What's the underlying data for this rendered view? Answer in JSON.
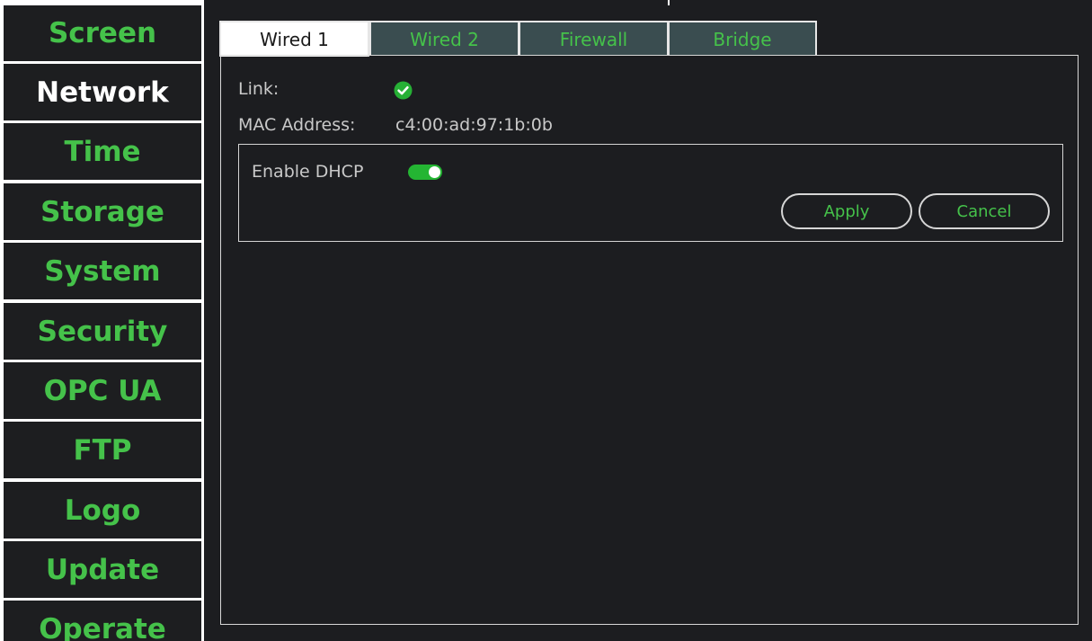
{
  "sidebar": {
    "items": [
      {
        "label": "Screen",
        "active": false
      },
      {
        "label": "Network",
        "active": true
      },
      {
        "label": "Time",
        "active": false
      },
      {
        "label": "Storage",
        "active": false
      },
      {
        "label": "System",
        "active": false
      },
      {
        "label": "Security",
        "active": false
      },
      {
        "label": "OPC UA",
        "active": false
      },
      {
        "label": "FTP",
        "active": false
      },
      {
        "label": "Logo",
        "active": false
      },
      {
        "label": "Update",
        "active": false
      },
      {
        "label": "Operate",
        "active": false
      }
    ]
  },
  "tabs": [
    {
      "label": "Wired 1",
      "active": true
    },
    {
      "label": "Wired 2",
      "active": false
    },
    {
      "label": "Firewall",
      "active": false
    },
    {
      "label": "Bridge",
      "active": false
    }
  ],
  "network": {
    "link_label": "Link:",
    "link_status_icon": "check-circle-icon",
    "link_status": "connected",
    "mac_label": "MAC Address:",
    "mac_value": "c4:00:ad:97:1b:0b",
    "dhcp_label": "Enable DHCP",
    "dhcp_enabled": true,
    "apply_label": "Apply",
    "cancel_label": "Cancel"
  },
  "colors": {
    "accent_green": "#45c24a",
    "toggle_on": "#24b533",
    "panel_bg": "#1c1d20",
    "inactive_tab_bg": "#3a4d50"
  }
}
